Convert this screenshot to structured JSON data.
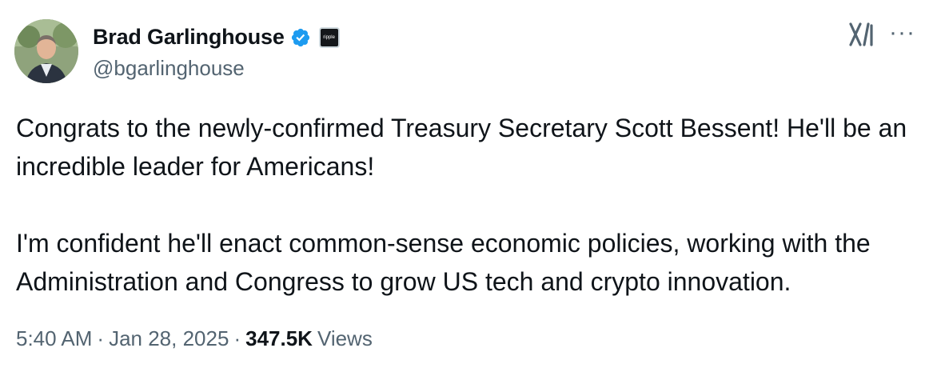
{
  "author": {
    "display_name": "Brad Garlinghouse",
    "handle": "@bgarlinghouse",
    "verified_icon": "verified-badge-icon",
    "affiliate_label": "ripple"
  },
  "tweet": {
    "paragraph1": "Congrats to the newly-confirmed Treasury Secretary Scott Bessent! He'll be an incredible leader for Americans!",
    "paragraph2": "I'm confident he'll enact common-sense economic policies, working with the Administration and Congress to grow US tech and crypto innovation."
  },
  "meta": {
    "time": "5:40 AM",
    "separator": "·",
    "date": "Jan 28, 2025",
    "views_count": "347.5K",
    "views_label": "Views"
  },
  "actions": {
    "more_label": "···",
    "logo_icon": "x-logo-icon"
  },
  "colors": {
    "text": "#0f1419",
    "secondary": "#536471",
    "verified": "#1d9bf0"
  }
}
